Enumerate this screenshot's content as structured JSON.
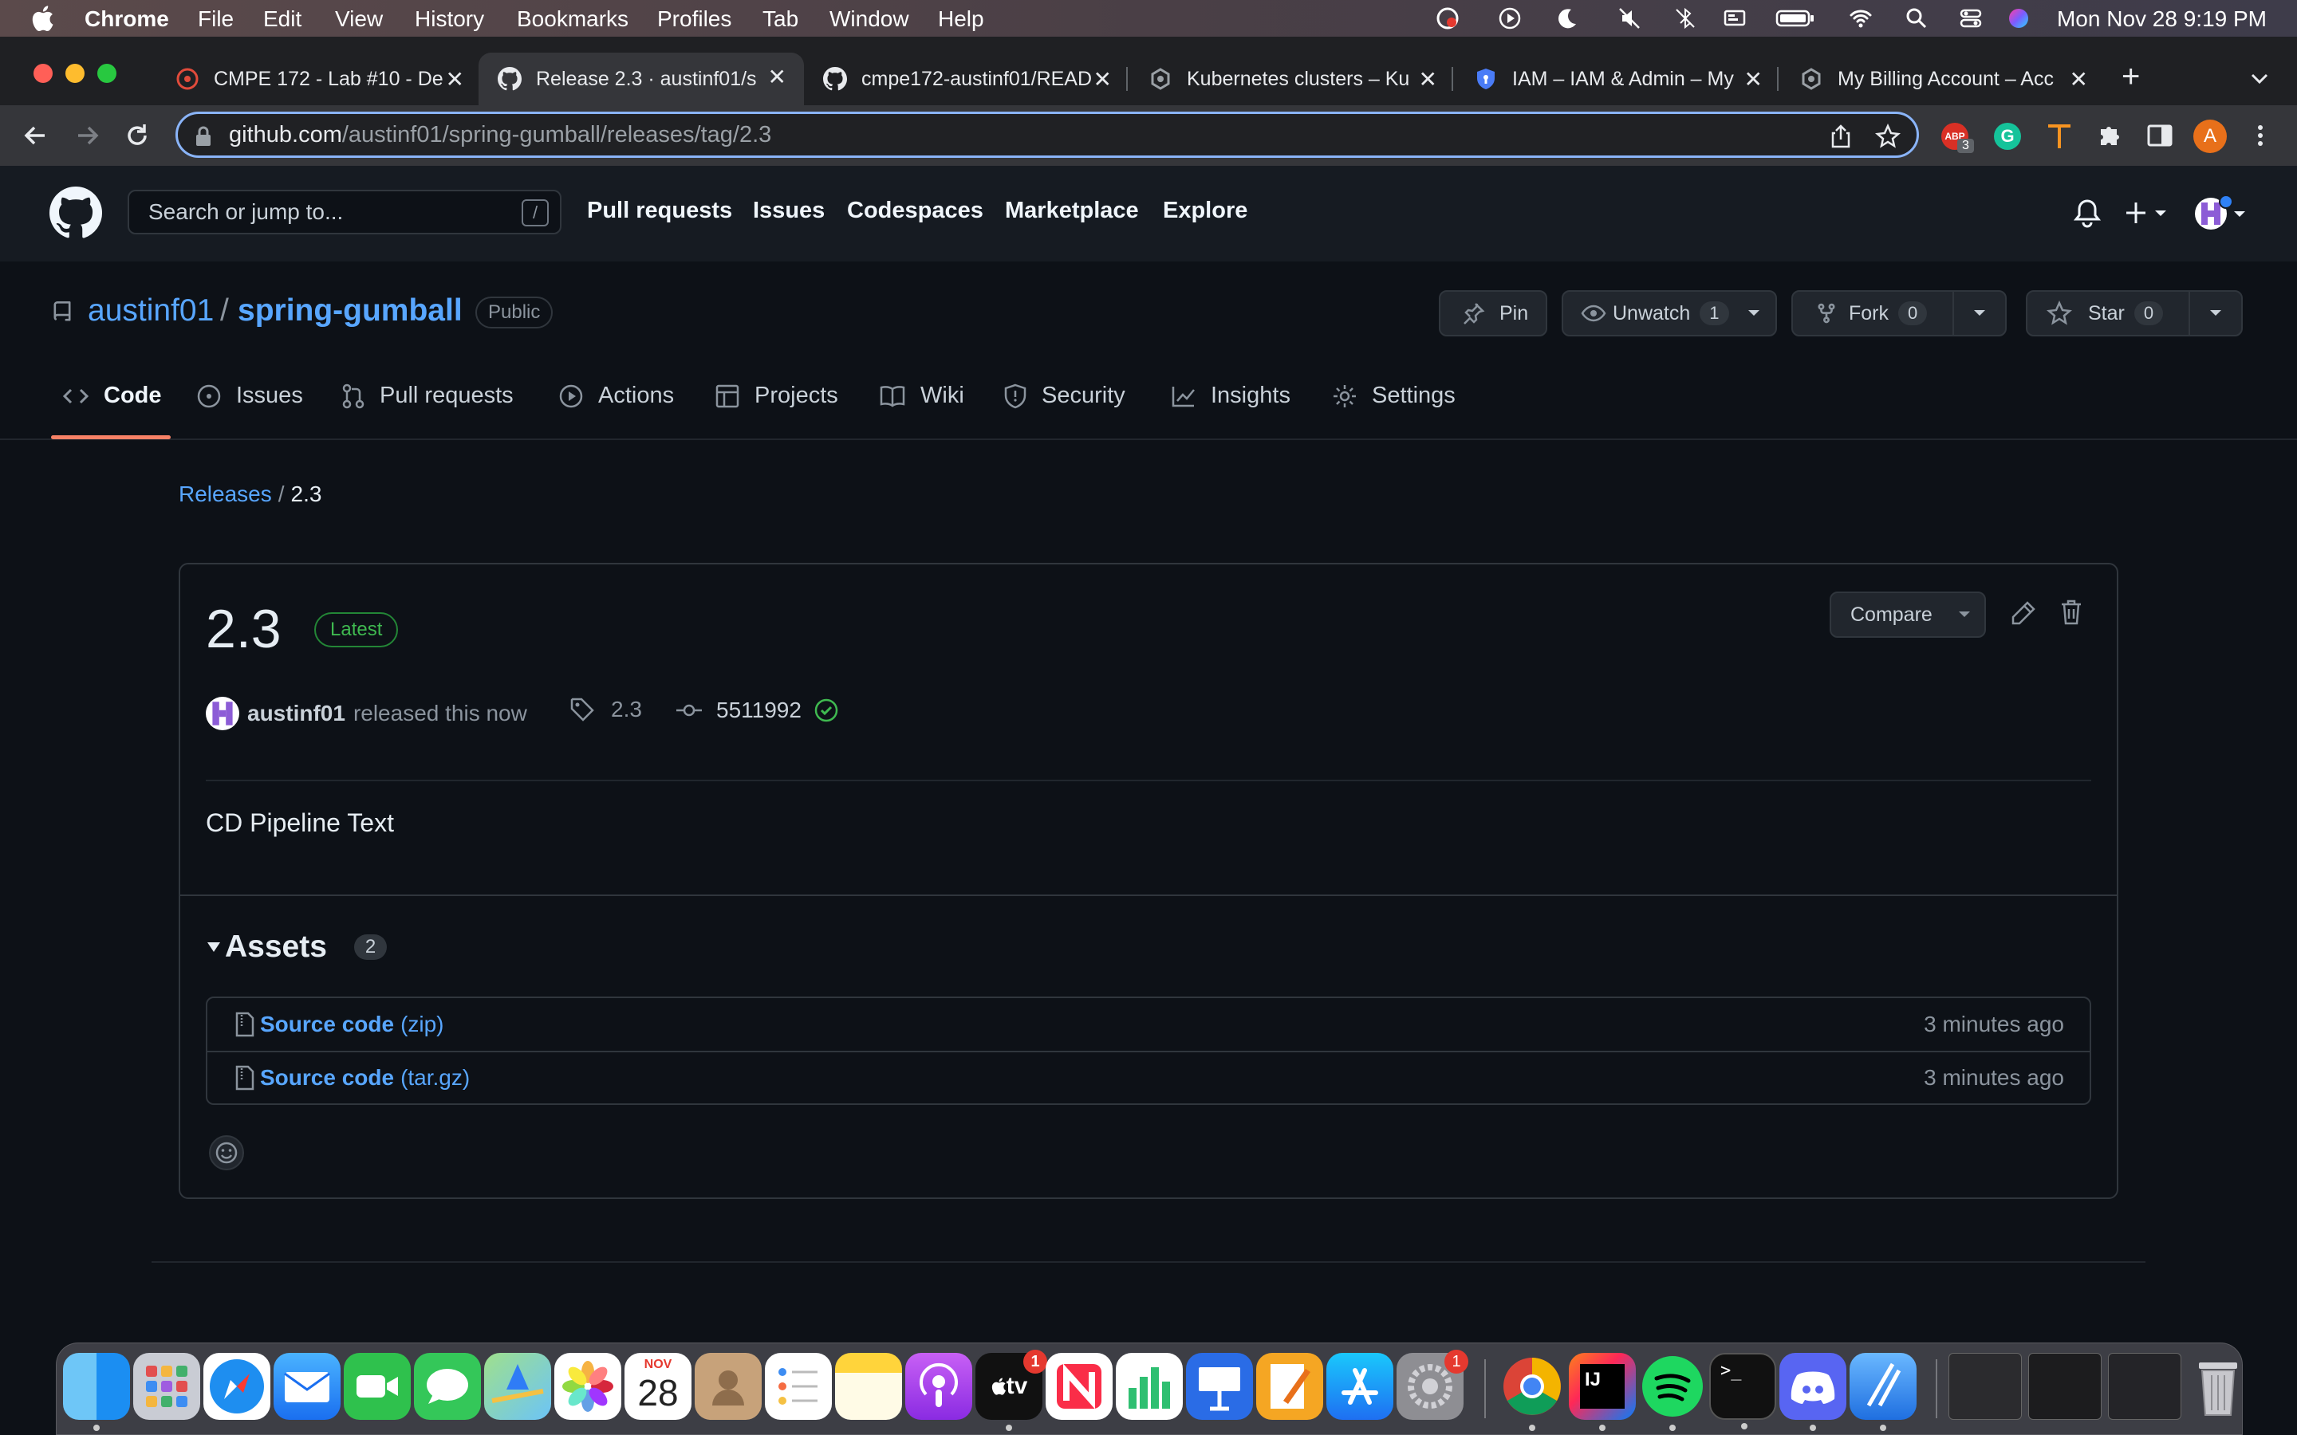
{
  "menubar": {
    "app": "Chrome",
    "items": [
      "File",
      "Edit",
      "View",
      "History",
      "Bookmarks",
      "Profiles",
      "Tab",
      "Window",
      "Help"
    ],
    "datetime": "Mon Nov 28  9:19 PM"
  },
  "tabs": [
    {
      "label": "CMPE 172 - Lab #10 - De",
      "icon": "canvas-icon"
    },
    {
      "label": "Release 2.3 · austinf01/s",
      "icon": "github-icon",
      "active": true
    },
    {
      "label": "cmpe172-austinf01/READ",
      "icon": "github-icon"
    },
    {
      "label": "Kubernetes clusters – Ku",
      "icon": "gcp-icon"
    },
    {
      "label": "IAM – IAM & Admin – My",
      "icon": "shield-icon"
    },
    {
      "label": "My Billing Account – Acc",
      "icon": "gcp-icon"
    }
  ],
  "omnibox": {
    "host": "github.com",
    "path": "/austinf01/spring-gumball/releases/tag/2.3",
    "extension_badge": "3",
    "profile_initial": "A"
  },
  "github_header": {
    "search_placeholder": "Search or jump to...",
    "search_shortcut": "/",
    "nav": [
      "Pull requests",
      "Issues",
      "Codespaces",
      "Marketplace",
      "Explore"
    ]
  },
  "repo": {
    "owner": "austinf01",
    "separator": "/",
    "name": "spring-gumball",
    "visibility": "Public",
    "pin_label": "Pin",
    "watch_label": "Unwatch",
    "watch_count": "1",
    "fork_label": "Fork",
    "fork_count": "0",
    "star_label": "Star",
    "star_count": "0",
    "tabs": [
      {
        "label": "Code",
        "icon": "code-icon"
      },
      {
        "label": "Issues",
        "icon": "issue-icon"
      },
      {
        "label": "Pull requests",
        "icon": "pull-request-icon"
      },
      {
        "label": "Actions",
        "icon": "play-icon"
      },
      {
        "label": "Projects",
        "icon": "table-icon"
      },
      {
        "label": "Wiki",
        "icon": "book-icon"
      },
      {
        "label": "Security",
        "icon": "shield-icon"
      },
      {
        "label": "Insights",
        "icon": "graph-icon"
      },
      {
        "label": "Settings",
        "icon": "gear-icon"
      }
    ]
  },
  "breadcrumb": {
    "releases": "Releases",
    "sep": "/",
    "current": "2.3"
  },
  "release": {
    "title": "2.3",
    "badge": "Latest",
    "compare_label": "Compare",
    "author": "austinf01",
    "released_text": "released this now",
    "tag": "2.3",
    "commit": "5511992",
    "body": "CD Pipeline Text",
    "assets_label": "Assets",
    "assets_count": "2",
    "assets": [
      {
        "name": "Source code",
        "ext": "(zip)",
        "date": "3 minutes ago"
      },
      {
        "name": "Source code",
        "ext": "(tar.gz)",
        "date": "3 minutes ago"
      }
    ]
  },
  "dock": {
    "calendar_month": "NOV",
    "calendar_day": "28",
    "tv_label": "tv",
    "appletv_badge": "1",
    "settings_badge": "1",
    "intellij_label": "IJ",
    "terminal_label": ">_"
  }
}
